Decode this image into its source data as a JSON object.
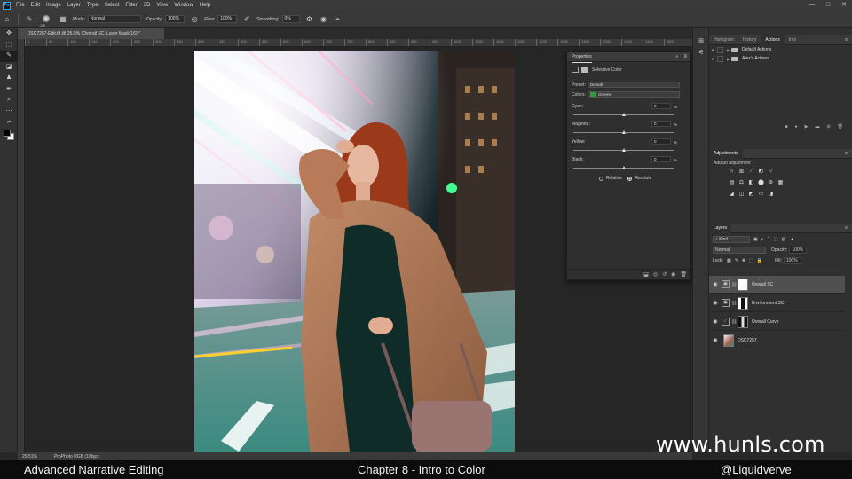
{
  "app": {
    "logo_label": "Ps",
    "menu": [
      "File",
      "Edit",
      "Image",
      "Layer",
      "Type",
      "Select",
      "Filter",
      "3D",
      "View",
      "Window",
      "Help"
    ],
    "window_controls": [
      "—",
      "□",
      "✕"
    ]
  },
  "options_bar": {
    "brush_size": "125",
    "mode_label": "Mode:",
    "mode_value": "Normal",
    "opacity_label": "Opacity:",
    "opacity_value": "100%",
    "flow_label": "Flow:",
    "flow_value": "100%",
    "smoothing_label": "Smoothing:",
    "smoothing_value": "0%"
  },
  "document": {
    "tab_title": "_DSC7257-Edit.tif @ 25.5% (Overall SC, Layer Mask/16) *",
    "ruler_ticks": [
      "0",
      "50",
      "100",
      "150",
      "200",
      "250",
      "300",
      "350",
      "400",
      "450",
      "500",
      "550",
      "600",
      "650",
      "700",
      "750",
      "800",
      "850",
      "900",
      "950",
      "1000",
      "1050",
      "1100",
      "1150",
      "1200",
      "1250",
      "1300",
      "1350",
      "1400",
      "1450",
      "1500"
    ],
    "zoom": "25.51%",
    "profile": "ProPhoto RGB (16bpc)"
  },
  "properties": {
    "title": "Properties",
    "adjustment_name": "Selective Color",
    "preset_label": "Preset:",
    "preset_value": "Default",
    "colors_label": "Colors:",
    "colors_value": "Greens",
    "colors_swatch": "#2f9e3a",
    "sliders": [
      {
        "label": "Cyan:",
        "value": "0",
        "unit": "%",
        "position": 0.5
      },
      {
        "label": "Magenta:",
        "value": "0",
        "unit": "%",
        "position": 0.5
      },
      {
        "label": "Yellow:",
        "value": "0",
        "unit": "%",
        "position": 0.5
      },
      {
        "label": "Black:",
        "value": "0",
        "unit": "%",
        "position": 0.5
      }
    ],
    "relative_label": "Relative",
    "absolute_label": "Absolute"
  },
  "actions_panel": {
    "tabs": [
      "Histogram",
      "History",
      "Actions",
      "Info"
    ],
    "active_tab": "Actions",
    "items": [
      "Default Actions",
      "Alex's Actions"
    ]
  },
  "adjustments_panel": {
    "title": "Adjustments",
    "subtitle": "Add an adjustment"
  },
  "layers_panel": {
    "title": "Layers",
    "filter_value": "Kind",
    "blend_mode": "Normal",
    "opacity_label": "Opacity:",
    "opacity_value": "100%",
    "lock_label": "Lock:",
    "fill_label": "Fill:",
    "fill_value": "100%",
    "layers": [
      {
        "name": "Overall SC",
        "selected": true
      },
      {
        "name": "Environment SC",
        "selected": false
      },
      {
        "name": "Overall Curve",
        "selected": false
      },
      {
        "name": "DSC7257",
        "selected": false
      }
    ]
  },
  "caption": {
    "left": "Advanced Narrative Editing",
    "center": "Chapter 8 - Intro to Color",
    "right": "@Liquidverve"
  },
  "watermark": "www.hunls.com"
}
